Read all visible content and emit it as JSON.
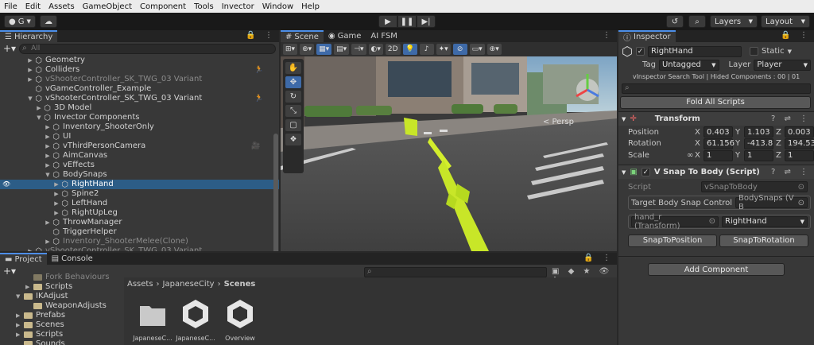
{
  "menu": [
    "File",
    "Edit",
    "Assets",
    "GameObject",
    "Component",
    "Tools",
    "Invector",
    "Window",
    "Help"
  ],
  "toolbar": {
    "account": "G",
    "layers": "Layers",
    "layout": "Layout"
  },
  "hierarchy": {
    "tab": "Hierarchy",
    "search_placeholder": "All",
    "rows": [
      {
        "label": "Geometry",
        "indent": 3,
        "arrow": "▶",
        "dim": false
      },
      {
        "label": "Colliders",
        "indent": 3,
        "arrow": "▶",
        "dim": false,
        "badge": true
      },
      {
        "label": "vShooterController_SK_TWG_03 Variant",
        "indent": 3,
        "arrow": "▶",
        "dim": true
      },
      {
        "label": "vGameController_Example",
        "indent": 3,
        "arrow": "",
        "dim": false
      },
      {
        "label": "vShooterController_SK_TWG_03 Variant",
        "indent": 3,
        "arrow": "▼",
        "dim": false,
        "badge": true
      },
      {
        "label": "3D Model",
        "indent": 4,
        "arrow": "▶",
        "dim": false
      },
      {
        "label": "Invector Components",
        "indent": 4,
        "arrow": "▼",
        "dim": false
      },
      {
        "label": "Inventory_ShooterOnly",
        "indent": 5,
        "arrow": "▶",
        "dim": false
      },
      {
        "label": "UI",
        "indent": 5,
        "arrow": "▶",
        "dim": false
      },
      {
        "label": "vThirdPersonCamera",
        "indent": 5,
        "arrow": "▶",
        "dim": false,
        "cam": true
      },
      {
        "label": "AimCanvas",
        "indent": 5,
        "arrow": "▶",
        "dim": false
      },
      {
        "label": "vEffects",
        "indent": 5,
        "arrow": "▶",
        "dim": false
      },
      {
        "label": "BodySnaps",
        "indent": 5,
        "arrow": "▼",
        "dim": false
      },
      {
        "label": "RightHand",
        "indent": 6,
        "arrow": "▶",
        "dim": false,
        "selected": true
      },
      {
        "label": "Spine2",
        "indent": 6,
        "arrow": "▶",
        "dim": false
      },
      {
        "label": "LeftHand",
        "indent": 6,
        "arrow": "▶",
        "dim": false
      },
      {
        "label": "RightUpLeg",
        "indent": 6,
        "arrow": "▶",
        "dim": false
      },
      {
        "label": "ThrowManager",
        "indent": 5,
        "arrow": "▶",
        "dim": false
      },
      {
        "label": "TriggerHelper",
        "indent": 5,
        "arrow": "",
        "dim": false
      },
      {
        "label": "Inventory_ShooterMelee(Clone)",
        "indent": 5,
        "arrow": "▶",
        "dim": true
      },
      {
        "label": "vShooterController_SK_TWG_03 Variant",
        "indent": 3,
        "arrow": "▶",
        "dim": true
      }
    ]
  },
  "scene": {
    "tabs": [
      "Scene",
      "Game",
      "AI FSM"
    ],
    "mode_2d": "2D",
    "persp": "< Persp"
  },
  "inspector": {
    "tab": "Inspector",
    "object_name": "RightHand",
    "static_label": "Static",
    "tag_label": "Tag",
    "tag_value": "Untagged",
    "layer_label": "Layer",
    "layer_value": "Player",
    "search_tool": "vInspector Search Tool | Hided Components : 00 | 01",
    "fold_all": "Fold All Scripts",
    "transform": {
      "title": "Transform",
      "position": {
        "label": "Position",
        "x": "0.403",
        "y": "1.103",
        "z": "0.003"
      },
      "rotation": {
        "label": "Rotation",
        "x": "61.156",
        "y": "-413.8",
        "z": "194.53"
      },
      "scale": {
        "label": "Scale",
        "x": "1",
        "y": "1",
        "z": "1"
      }
    },
    "snap": {
      "title": "V Snap To Body (Script)",
      "script_label": "Script",
      "script_value": "vSnapToBody",
      "target_label": "Target Body Snap Control",
      "target_value": "BodySnaps (V B",
      "bone_value": "hand_r (Transform)",
      "bone_select": "RightHand",
      "snap_position": "SnapToPosition",
      "snap_rotation": "SnapToRotation"
    },
    "add_component": "Add Component"
  },
  "project": {
    "tabs": [
      "Project",
      "Console"
    ],
    "folders": [
      {
        "label": "Fork Behaviours",
        "indent": 2,
        "arrow": ""
      },
      {
        "label": "Scripts",
        "indent": 2,
        "arrow": "▶"
      },
      {
        "label": "IKAdjust",
        "indent": 1,
        "arrow": "▼"
      },
      {
        "label": "WeaponAdjusts",
        "indent": 2,
        "arrow": ""
      },
      {
        "label": "Prefabs",
        "indent": 1,
        "arrow": "▶"
      },
      {
        "label": "Scenes",
        "indent": 1,
        "arrow": "▶"
      },
      {
        "label": "Scripts",
        "indent": 1,
        "arrow": "▶"
      },
      {
        "label": "Sounds",
        "indent": 1,
        "arrow": ""
      }
    ],
    "breadcrumb": [
      "Assets",
      "JapaneseCity",
      "Scenes"
    ],
    "assets": [
      "JapaneseC...",
      "JapaneseC...",
      "Overview"
    ],
    "count": "4"
  }
}
